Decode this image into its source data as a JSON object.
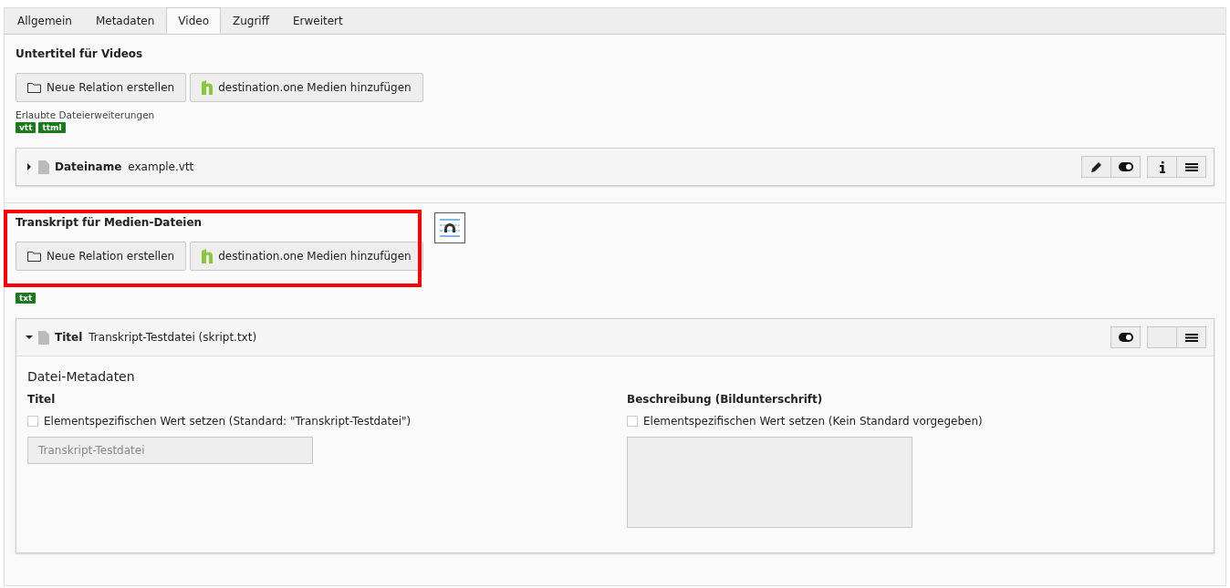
{
  "tabs": [
    {
      "label": "Allgemein",
      "selected": false
    },
    {
      "label": "Metadaten",
      "selected": false
    },
    {
      "label": "Video",
      "selected": true
    },
    {
      "label": "Zugriff",
      "selected": false
    },
    {
      "label": "Erweitert",
      "selected": false
    }
  ],
  "sections": [
    {
      "title": "Untertitel für Videos",
      "buttons": [
        {
          "kind": "folder",
          "label": "Neue Relation erstellen"
        },
        {
          "kind": "brand",
          "label": "destination.one Medien hinzufügen"
        }
      ],
      "extensions_label": "Erlaubte Dateierweiterungen",
      "extensions": [
        "vtt",
        "ttml"
      ],
      "records": [
        {
          "expanded": false,
          "key": "Dateiname",
          "value": "example.vtt",
          "control_groups": [
            [
              {
                "kind": "edit"
              },
              {
                "kind": "toggle"
              }
            ],
            [
              {
                "kind": "info"
              },
              {
                "kind": "menu"
              }
            ]
          ]
        }
      ]
    },
    {
      "title": "Transkript für Medien-Dateien",
      "highlighted": true,
      "buttons": [
        {
          "kind": "folder",
          "label": "Neue Relation erstellen"
        },
        {
          "kind": "brand",
          "label": "destination.one Medien hinzufügen"
        }
      ],
      "extensions": [
        "txt"
      ],
      "records": [
        {
          "expanded": true,
          "key": "Titel",
          "value": "Transkript-Testdatei (skript.txt)",
          "control_groups": [
            [
              {
                "kind": "toggle"
              }
            ],
            [
              {
                "kind": "blank"
              },
              {
                "kind": "menu"
              }
            ]
          ],
          "metadata": {
            "heading": "Datei-Metadaten",
            "fields": [
              {
                "label": "Titel",
                "checkbox_label": "Elementspezifischen Wert setzen (Standard: \"Transkript-Testdatei\")",
                "checked": false,
                "kind": "input",
                "placeholder": "Transkript-Testdatei"
              },
              {
                "label": "Beschreibung (Bildunterschrift)",
                "checkbox_label": "Elementspezifischen Wert setzen (Kein Standard vorgegeben)",
                "checked": false,
                "kind": "textarea"
              }
            ]
          }
        }
      ]
    }
  ]
}
